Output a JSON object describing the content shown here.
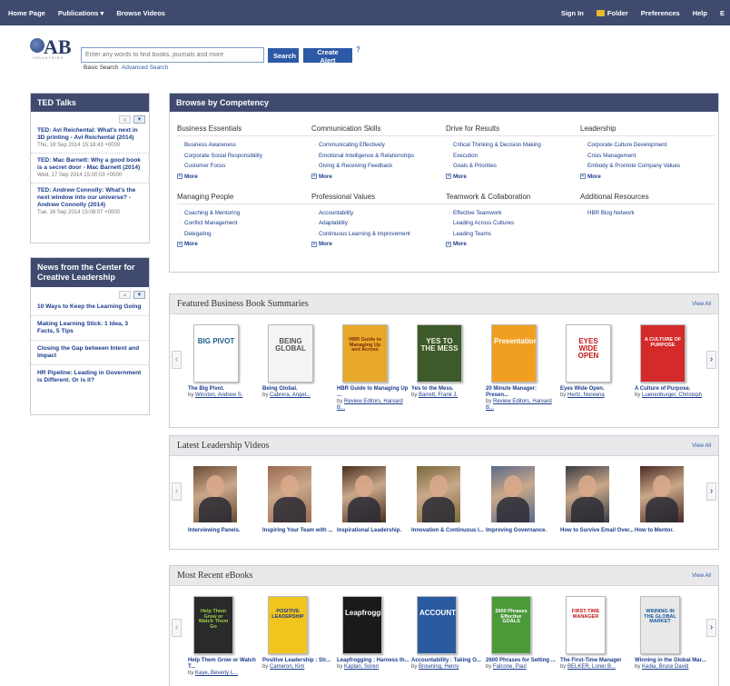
{
  "topnav": {
    "left": [
      "Home Page",
      "Publications ▾",
      "Browse Videos"
    ],
    "right": [
      "Sign In",
      "Folder",
      "Preferences",
      "Help",
      "E"
    ]
  },
  "logo": {
    "text": "AB",
    "sub": "INDUSTRIES"
  },
  "search": {
    "placeholder": "Enter any words to find books, journals and more",
    "search_label": "Search",
    "alert_label": "Create Alert",
    "help": "?",
    "basic_label": "Basic Search",
    "advanced_label": "Advanced Search"
  },
  "ted": {
    "title": "TED Talks",
    "items": [
      {
        "title": "TED: Avi Reichental: What's next in 3D printing - Avi Reichental (2014)",
        "date": "Thu, 18 Sep 2014 15:18:43 +0000"
      },
      {
        "title": "TED: Mac Barnett: Why a good book is a secret door - Mac Barnett (2014)",
        "date": "Wed, 17 Sep 2014 15:00:03 +0000"
      },
      {
        "title": "TED: Andrew Connolly: What's the next window into our universe? - Andrew Connolly (2014)",
        "date": "Tue, 16 Sep 2014 15:08:07 +0000"
      }
    ]
  },
  "news": {
    "title": "News from the Center for Creative Leadership",
    "items": [
      "10 Ways to Keep the Learning Going",
      "Making Learning Stick: 1 Idea, 3 Facts, 5 Tips",
      "Closing the Gap between Intent and Impact",
      "HR Pipeline: Leading in Government is Different. Or is it?"
    ]
  },
  "browse": {
    "title": "Browse by Competency",
    "more_label": "More",
    "columns": [
      {
        "heading": "Business Essentials",
        "items": [
          "Business Awareness",
          "Corporate Social Responsibility",
          "Customer Focus"
        ],
        "more": true
      },
      {
        "heading": "Communication Skills",
        "items": [
          "Communicating Effectively",
          "Emotional Intelligence & Relationships",
          "Giving & Receiving Feedback"
        ],
        "more": true
      },
      {
        "heading": "Drive for Results",
        "items": [
          "Critical Thinking & Decision Making",
          "Execution",
          "Goals & Priorities"
        ],
        "more": true
      },
      {
        "heading": "Leadership",
        "items": [
          "Corporate Culture Development",
          "Crisis Management",
          "Embody & Promote Company Values"
        ],
        "more": true
      },
      {
        "heading": "Managing People",
        "items": [
          "Coaching & Mentoring",
          "Conflict Management",
          "Delegating"
        ],
        "more": true
      },
      {
        "heading": "Professional Values",
        "items": [
          "Accountability",
          "Adaptability",
          "Continuous Learning & Improvement"
        ],
        "more": true
      },
      {
        "heading": "Teamwork & Collaboration",
        "items": [
          "Effective Teamwork",
          "Leading Across Cultures",
          "Leading Teams"
        ],
        "more": true
      },
      {
        "heading": "Additional Resources",
        "items": [
          "HBR Blog Network"
        ],
        "more": false
      }
    ]
  },
  "featured": {
    "title": "Featured Business Book Summaries",
    "view_all": "View All",
    "items": [
      {
        "title": "The Big Pivot.",
        "by": "by",
        "author": "Winston, Andrew S.",
        "cover_text": "BIG PIVOT",
        "bg": "#ffffff",
        "fg": "#1f5f8a"
      },
      {
        "title": "Being Global.",
        "by": "by",
        "author": "Cabrera, Angel...",
        "cover_text": "BEING GLOBAL",
        "bg": "#f4f4f4",
        "fg": "#555555"
      },
      {
        "title": "HBR Guide to Managing Up ...",
        "by": "by",
        "author": "Review Editors, Harvard B...",
        "cover_text": "HBR Guide to Managing Up and Across",
        "bg": "#e8a92a",
        "fg": "#7a2a0a"
      },
      {
        "title": "Yes to the Mess.",
        "by": "by",
        "author": "Barrett, Frank J.",
        "cover_text": "YES TO THE MESS",
        "bg": "#3d5a2a",
        "fg": "#f0f0e0"
      },
      {
        "title": "20 Minute Manager: Presen...",
        "by": "by",
        "author": "Review Editors, Harvard B...",
        "cover_text": "Presentations",
        "bg": "#f0a020",
        "fg": "#ffffff"
      },
      {
        "title": "Eyes Wide Open.",
        "by": "by",
        "author": "Hertz, Noreena",
        "cover_text": "EYES WIDE OPEN",
        "bg": "#ffffff",
        "fg": "#c01818"
      },
      {
        "title": "A Culture of Purpose.",
        "by": "by",
        "author": "Luenenburger, Christoph",
        "cover_text": "A CULTURE OF PURPOSE",
        "bg": "#d42a2a",
        "fg": "#ffffff"
      }
    ]
  },
  "videos": {
    "title": "Latest Leadership Videos",
    "view_all": "View All",
    "items": [
      {
        "title": "Interviewing Panels.",
        "bg": "#6a4a34"
      },
      {
        "title": "Inspiring Your Team with ...",
        "bg": "#9a6a52"
      },
      {
        "title": "Inspirational Leadership.",
        "bg": "#4a3020"
      },
      {
        "title": "Innovation & Continuous I...",
        "bg": "#7a6a3a"
      },
      {
        "title": "Improving Governance.",
        "bg": "#5a6a8a"
      },
      {
        "title": "How to Survive Email Over...",
        "bg": "#3a3a44"
      },
      {
        "title": "How to Mentor.",
        "bg": "#4a2a24"
      }
    ]
  },
  "ebooks": {
    "title": "Most Recent eBooks",
    "view_all": "View All",
    "items": [
      {
        "title": "Help Them Grow or Watch T...",
        "by": "by",
        "author": "Kaye, Beverly L...",
        "cover_text": "Help Them Grow or Watch Them Go",
        "bg": "#2a2a2a",
        "fg": "#9ad04a"
      },
      {
        "title": "Positive Leadership : Str...",
        "by": "by",
        "author": "Cameron, Kim",
        "cover_text": "POSITIVE LEADERSHIP",
        "bg": "#f2c41e",
        "fg": "#1a3c8c"
      },
      {
        "title": "Leapfrogging : Harness th...",
        "by": "by",
        "author": "Kaplan, Soren",
        "cover_text": "Leapfrogging",
        "bg": "#1a1a1a",
        "fg": "#ffffff"
      },
      {
        "title": "Accountability : Taking O...",
        "by": "by",
        "author": "Browning, Henry",
        "cover_text": "ACCOUNTABILITY",
        "bg": "#2a5aa0",
        "fg": "#ffffff"
      },
      {
        "title": "2600 Phrases for Setting ...",
        "by": "by",
        "author": "Falcone, Paul",
        "cover_text": "2600 Phrases Effective GOALS",
        "bg": "#4a9a3a",
        "fg": "#ffffff"
      },
      {
        "title": "The First-Time Manager",
        "by": "by",
        "author": "BELKER, Loren B...",
        "cover_text": "FIRST-TIME MANAGER",
        "bg": "#ffffff",
        "fg": "#c01818"
      },
      {
        "title": "Winning in the Global Mar...",
        "by": "by",
        "author": "Kedia, Bruce David",
        "cover_text": "WINNING IN THE GLOBAL MARKET",
        "bg": "#e8e8e8",
        "fg": "#1a5aa0"
      }
    ]
  }
}
